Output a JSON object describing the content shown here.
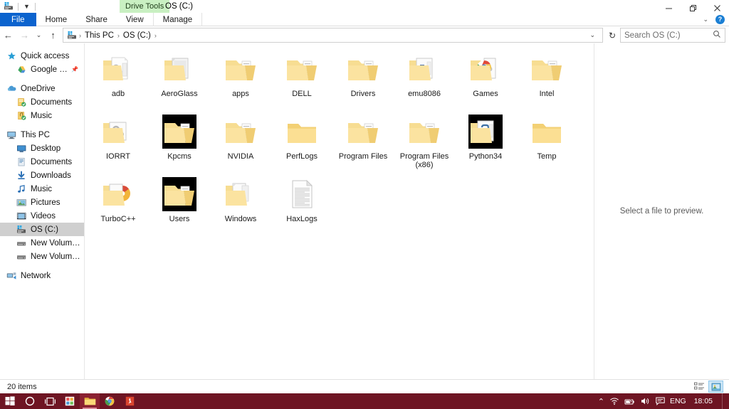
{
  "window": {
    "title": "OS (C:)",
    "contextual_tab": "Drive Tools",
    "quick_access_icons": [
      "drive-icon",
      "customize-dropdown-icon"
    ],
    "controls": {
      "minimize": "minimize-icon",
      "restore": "restore-icon",
      "close": "close-icon"
    }
  },
  "ribbon": {
    "tabs": [
      {
        "label": "File",
        "id": "file"
      },
      {
        "label": "Home",
        "id": "home"
      },
      {
        "label": "Share",
        "id": "share"
      },
      {
        "label": "View",
        "id": "view"
      },
      {
        "label": "Manage",
        "id": "manage"
      }
    ],
    "expand_label": "⌄",
    "help_label": "?"
  },
  "nav": {
    "back": "←",
    "forward": "→",
    "recent": "⌄",
    "up": "↑",
    "breadcrumb": [
      "This PC",
      "OS (C:)"
    ],
    "breadcrumb_separator": "›",
    "dropdown": "⌄",
    "refresh": "↻"
  },
  "search": {
    "placeholder": "Search OS (C:)",
    "value": "",
    "icon": "search-icon"
  },
  "sidebar": {
    "items": [
      {
        "label": "Quick access",
        "icon": "star-icon",
        "indent": 0,
        "selected": false,
        "pinned": false
      },
      {
        "label": "Google Drive",
        "icon": "google-drive-icon",
        "indent": 1,
        "selected": false,
        "pinned": true
      },
      {
        "label": "OneDrive",
        "icon": "cloud-icon",
        "indent": 0,
        "selected": false,
        "pinned": false,
        "gap_before": true
      },
      {
        "label": "Documents",
        "icon": "documents-sync-icon",
        "indent": 1,
        "selected": false,
        "pinned": false
      },
      {
        "label": "Music",
        "icon": "music-sync-icon",
        "indent": 1,
        "selected": false,
        "pinned": false
      },
      {
        "label": "This PC",
        "icon": "computer-icon",
        "indent": 0,
        "selected": false,
        "pinned": false,
        "gap_before": true
      },
      {
        "label": "Desktop",
        "icon": "desktop-icon",
        "indent": 1,
        "selected": false,
        "pinned": false
      },
      {
        "label": "Documents",
        "icon": "documents-icon",
        "indent": 1,
        "selected": false,
        "pinned": false
      },
      {
        "label": "Downloads",
        "icon": "downloads-icon",
        "indent": 1,
        "selected": false,
        "pinned": false
      },
      {
        "label": "Music",
        "icon": "music-icon",
        "indent": 1,
        "selected": false,
        "pinned": false
      },
      {
        "label": "Pictures",
        "icon": "pictures-icon",
        "indent": 1,
        "selected": false,
        "pinned": false
      },
      {
        "label": "Videos",
        "icon": "videos-icon",
        "indent": 1,
        "selected": false,
        "pinned": false
      },
      {
        "label": "OS (C:)",
        "icon": "drive-icon",
        "indent": 1,
        "selected": true,
        "pinned": false
      },
      {
        "label": "New Volume (E:)",
        "icon": "disk-icon",
        "indent": 1,
        "selected": false,
        "pinned": false
      },
      {
        "label": "New Volume (F:)",
        "icon": "disk-icon",
        "indent": 1,
        "selected": false,
        "pinned": false
      },
      {
        "label": "Network",
        "icon": "network-icon",
        "indent": 0,
        "selected": false,
        "pinned": false,
        "gap_before": true
      }
    ]
  },
  "files": {
    "items": [
      {
        "name": "adb",
        "icon": "folder-documents-icon",
        "selected": false
      },
      {
        "name": "AeroGlass",
        "icon": "folder-page-icon",
        "selected": false
      },
      {
        "name": "apps",
        "icon": "folder-files-icon",
        "selected": false
      },
      {
        "name": "DELL",
        "icon": "folder-files-icon",
        "selected": false
      },
      {
        "name": "Drivers",
        "icon": "folder-files-icon",
        "selected": false
      },
      {
        "name": "emu8086",
        "icon": "folder-app-icon",
        "selected": false
      },
      {
        "name": "Games",
        "icon": "folder-chrome-icon",
        "selected": false
      },
      {
        "name": "Intel",
        "icon": "folder-files-icon",
        "selected": false
      },
      {
        "name": "IORRT",
        "icon": "folder-settings-icon",
        "selected": false
      },
      {
        "name": "Kpcms",
        "icon": "folder-files-icon",
        "selected": true
      },
      {
        "name": "NVIDIA",
        "icon": "folder-files-icon",
        "selected": false
      },
      {
        "name": "PerfLogs",
        "icon": "folder-empty-icon",
        "selected": false
      },
      {
        "name": "Program Files",
        "icon": "folder-files-icon",
        "selected": false
      },
      {
        "name": "Program Files (x86)",
        "icon": "folder-files-icon",
        "selected": false
      },
      {
        "name": "Python34",
        "icon": "folder-python-icon",
        "selected": true
      },
      {
        "name": "Temp",
        "icon": "folder-empty-icon",
        "selected": false
      },
      {
        "name": "TurboC++",
        "icon": "folder-disc-icon",
        "selected": false
      },
      {
        "name": "Users",
        "icon": "folder-files-icon",
        "selected": true
      },
      {
        "name": "Windows",
        "icon": "folder-windows-icon",
        "selected": false
      },
      {
        "name": "HaxLogs",
        "icon": "text-file-icon",
        "selected": false
      }
    ]
  },
  "preview": {
    "message": "Select a file to preview."
  },
  "statusbar": {
    "item_count": "20 items",
    "views": [
      {
        "name": "details-view",
        "active": false
      },
      {
        "name": "large-icons-view",
        "active": true
      }
    ]
  },
  "taskbar": {
    "items": [
      {
        "name": "start-button",
        "icon": "windows-logo-icon",
        "active": false
      },
      {
        "name": "cortana-button",
        "icon": "circle-icon",
        "active": false
      },
      {
        "name": "task-view-button",
        "icon": "task-view-icon",
        "active": false
      },
      {
        "name": "store-button",
        "icon": "store-icon",
        "active": false
      },
      {
        "name": "file-explorer-button",
        "icon": "folder-icon",
        "active": true
      },
      {
        "name": "chrome-button",
        "icon": "chrome-icon",
        "active": false
      },
      {
        "name": "pdf-app-button",
        "icon": "pdf-icon",
        "active": false
      }
    ],
    "tray": {
      "chevron": "⌃",
      "icons": [
        "wifi-icon",
        "battery-icon",
        "volume-icon",
        "action-center-icon"
      ],
      "language": "ENG",
      "clock": "18:05"
    },
    "color": "#6e1523"
  }
}
